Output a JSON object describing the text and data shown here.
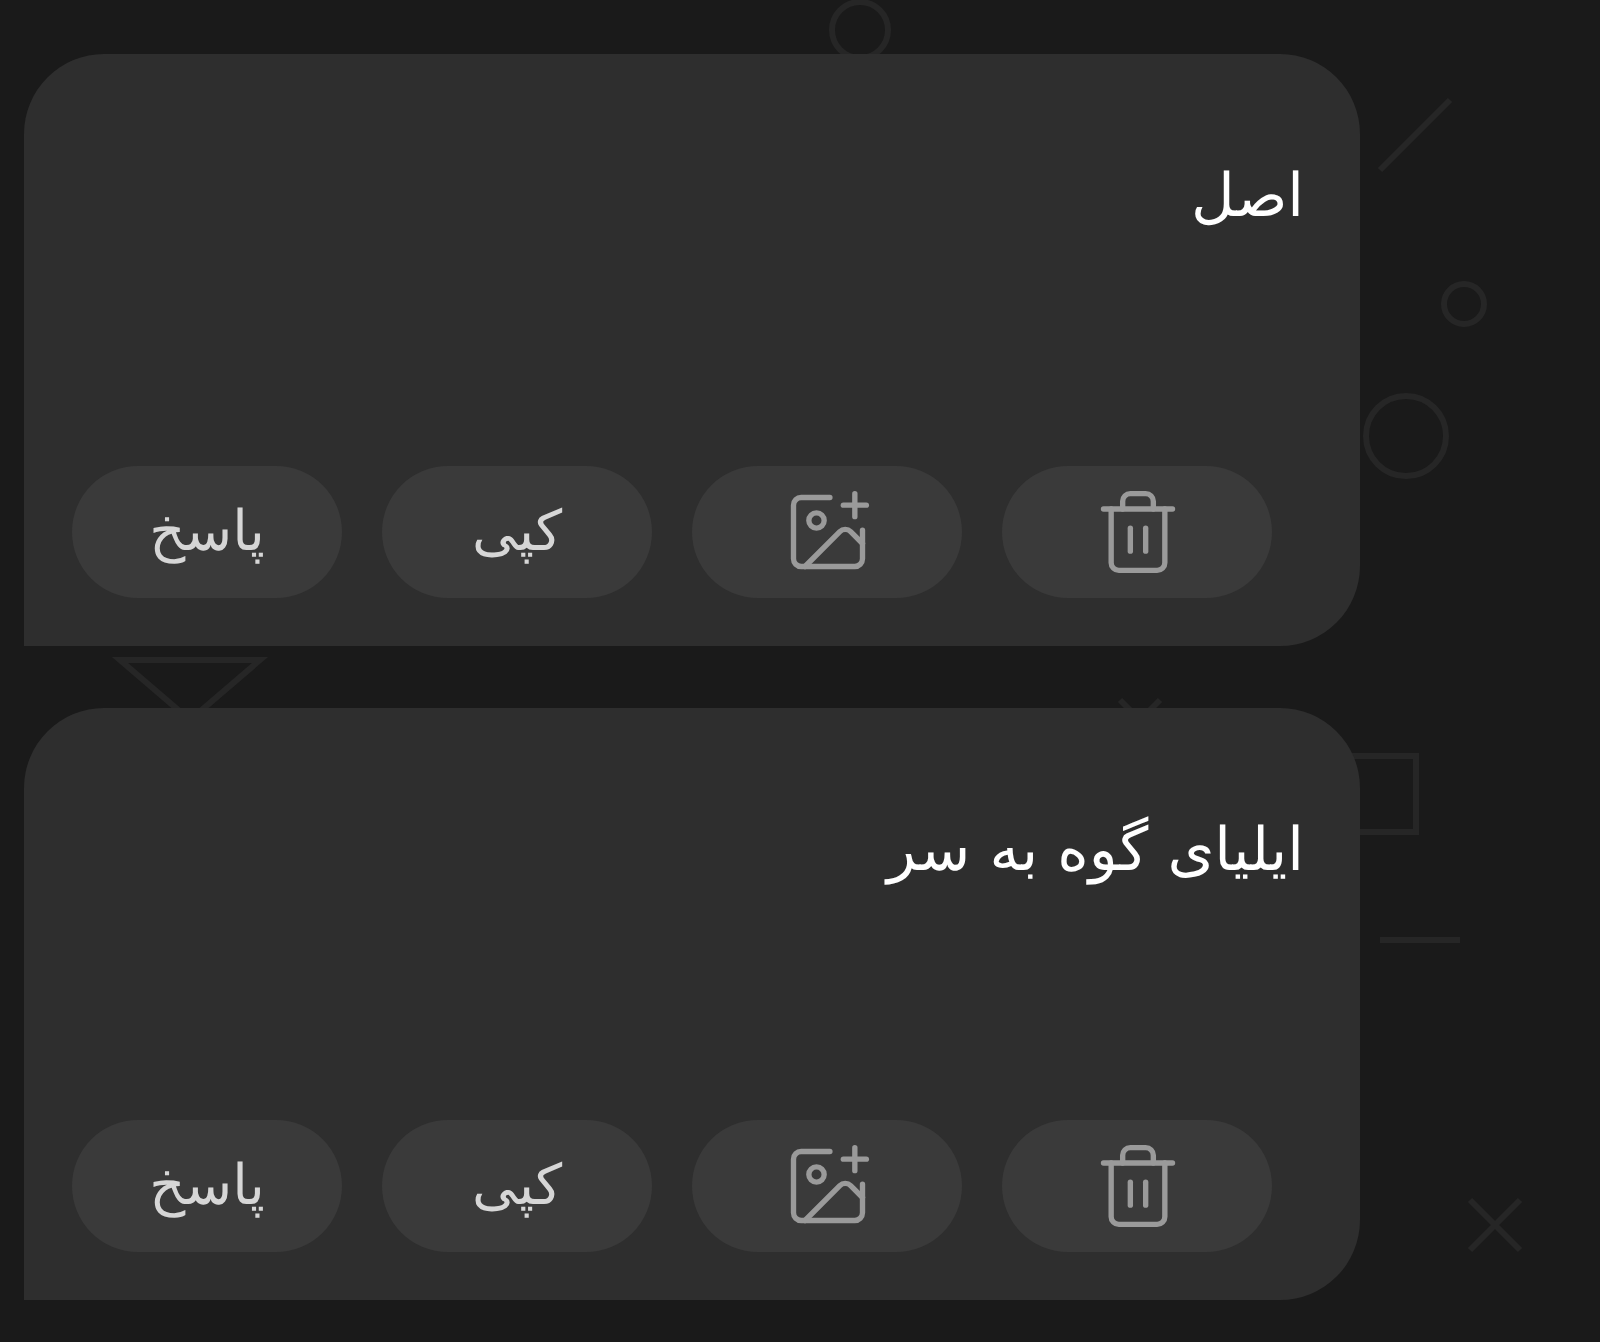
{
  "messages": [
    {
      "text": "اصل",
      "actions": [
        {
          "kind": "delete"
        },
        {
          "kind": "add-image"
        },
        {
          "kind": "text",
          "label": "کپی"
        },
        {
          "kind": "text",
          "label": "پاسخ"
        }
      ]
    },
    {
      "text": "ایلیای گوه به سر",
      "actions": [
        {
          "kind": "delete"
        },
        {
          "kind": "add-image"
        },
        {
          "kind": "text",
          "label": "کپی"
        },
        {
          "kind": "text",
          "label": "پاسخ"
        }
      ]
    }
  ]
}
